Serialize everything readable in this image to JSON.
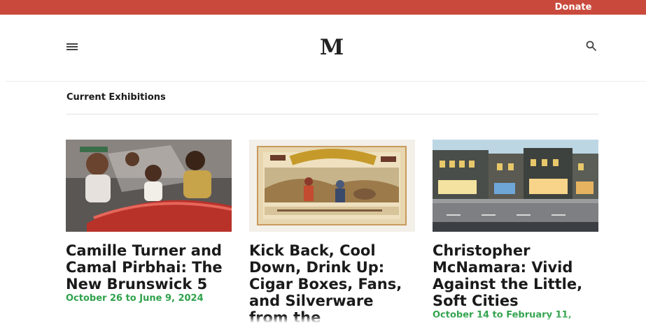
{
  "topbar": {
    "donate_label": "Donate"
  },
  "header": {
    "logo": "M",
    "menu_icon": "hamburger-menu-icon",
    "search_icon": "search-icon"
  },
  "section": {
    "title": "Current Exhibitions"
  },
  "exhibitions": [
    {
      "title": "Camille Turner and Camal Pirbhai: The New Brunswick 5",
      "date": "October 26 to June 9, 2024",
      "image": "photo of people riding in a red convertible car"
    },
    {
      "title": "Kick Back, Cool Down, Drink Up: Cigar Boxes, Fans, and Silverware from the",
      "date": "",
      "image": "vintage Kelly's Gold cigar box label with gold prospectors"
    },
    {
      "title": "Christopher McNamara: Vivid Against the Little, Soft Cities",
      "date": "October 14 to February 11,",
      "image": "miniature model of illuminated storefronts on a street"
    }
  ],
  "colors": {
    "topbar": "#c94a3c",
    "date_green": "#2fa24c"
  }
}
